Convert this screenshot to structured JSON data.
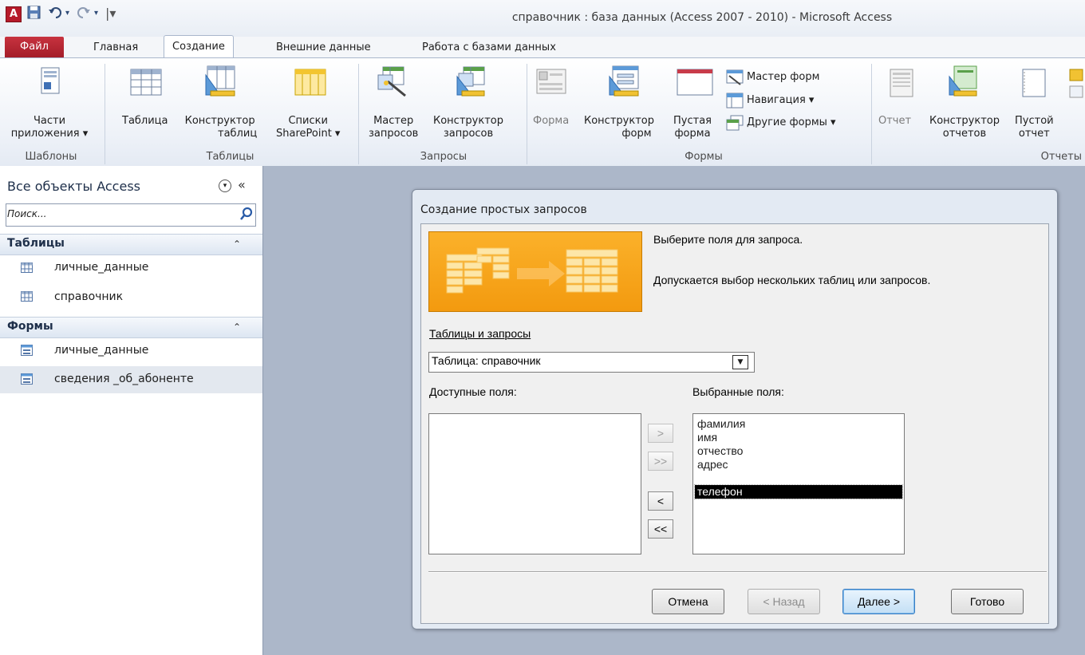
{
  "window": {
    "title": "справочник : база данных (Access 2007 - 2010)  -  Microsoft Access",
    "app_icon_letter": "A"
  },
  "quick_access": {
    "save_icon": "save-icon",
    "undo_icon": "undo-icon",
    "redo_icon": "redo-icon",
    "customize_icon": "customize-icon"
  },
  "tabs": [
    {
      "label": "Файл"
    },
    {
      "label": "Главная"
    },
    {
      "label": "Создание"
    },
    {
      "label": "Внешние данные"
    },
    {
      "label": "Работа с базами данных"
    }
  ],
  "ribbon": {
    "groups": {
      "templates": "Шаблоны",
      "tables": "Таблицы",
      "queries": "Запросы",
      "forms": "Формы",
      "reports": "Отчеты"
    },
    "buttons": {
      "app_parts": [
        "Части",
        "приложения ▾"
      ],
      "table": "Таблица",
      "table_designer": [
        "Конструктор",
        "таблиц"
      ],
      "sharepoint_lists": [
        "Списки",
        "SharePoint ▾"
      ],
      "query_wizard": [
        "Мастер",
        "запросов"
      ],
      "query_designer": [
        "Конструктор",
        "запросов"
      ],
      "form": "Форма",
      "form_designer": [
        "Конструктор",
        "форм"
      ],
      "blank_form": [
        "Пустая",
        "форма"
      ],
      "form_wizard": "Мастер форм",
      "navigation": "Навигация ▾",
      "other_forms": "Другие формы ▾",
      "report": "Отчет",
      "report_designer": [
        "Конструктор",
        "отчетов"
      ],
      "blank_report": [
        "Пустой",
        "отчет"
      ]
    }
  },
  "nav": {
    "title": "Все объекты Access",
    "search_placeholder": "Поиск...",
    "groups": [
      {
        "label": "Таблицы",
        "items": [
          "личные_данные",
          "справочник"
        ]
      },
      {
        "label": "Формы",
        "items": [
          "личные_данные",
          "сведения _об_абоненте"
        ]
      }
    ]
  },
  "dialog": {
    "title": "Создание простых запросов",
    "instruction1": "Выберите поля для запроса.",
    "instruction2": "Допускается выбор нескольких таблиц или запросов.",
    "tables_label": "Таблицы и запросы",
    "tables_value": "Таблица: справочник",
    "available_label": "Доступные поля:",
    "selected_label": "Выбранные поля:",
    "available_fields": [],
    "selected_fields": [
      "фамилия",
      "имя",
      "отчество",
      "адрес",
      "телефон"
    ],
    "selected_index": 4,
    "move_buttons": [
      ">",
      ">>",
      "<",
      "<<"
    ],
    "buttons": {
      "cancel": "Отмена",
      "back": "< Назад",
      "next": "Далее >",
      "finish": "Готово"
    }
  }
}
